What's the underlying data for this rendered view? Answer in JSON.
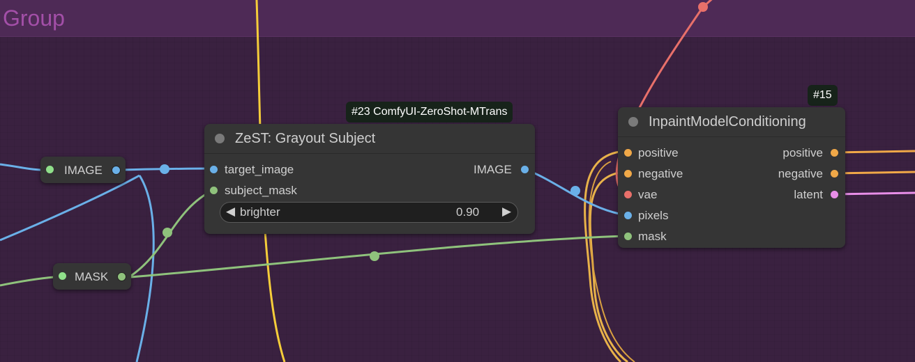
{
  "group": {
    "title": "Group"
  },
  "colors": {
    "image_wire": "#6ab0e8",
    "mask_wire": "#8fc27c",
    "conditioning_wire": "#f0a848",
    "vae_wire": "#e8706a",
    "latent_wire": "#e88ee8",
    "clip_wire": "#f5cd3a"
  },
  "reroute_image": {
    "label": "IMAGE",
    "icon": "image-port-icon"
  },
  "reroute_mask": {
    "label": "MASK",
    "icon": "mask-port-icon"
  },
  "zest_node": {
    "tag": "#23 ComfyUI-ZeroShot-MTrans",
    "title": "ZeST: Grayout Subject",
    "inputs": [
      "target_image",
      "subject_mask"
    ],
    "output": "IMAGE",
    "widget": {
      "label": "brighter",
      "value": "0.90",
      "left_arrow": "◀",
      "right_arrow": "▶"
    }
  },
  "inpaint_node": {
    "tag": "#15",
    "title": "InpaintModelConditioning",
    "inputs": [
      "positive",
      "negative",
      "vae",
      "pixels",
      "mask"
    ],
    "outputs": [
      "positive",
      "negative",
      "latent"
    ]
  }
}
